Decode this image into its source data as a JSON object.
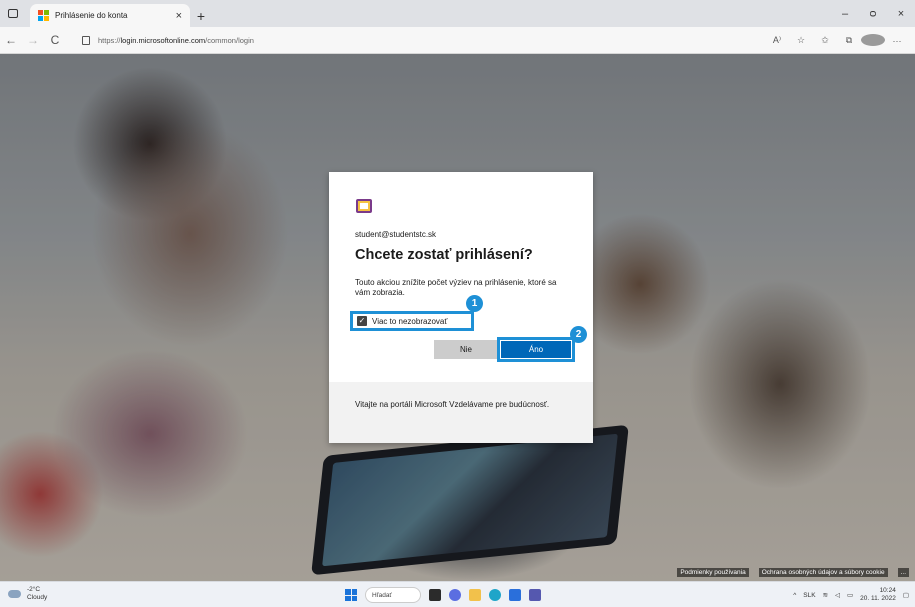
{
  "browser": {
    "tab_title": "Prihlásenie do konta",
    "tab_close": "×",
    "new_tab": "+",
    "url_prefix": "https://",
    "url_host": "login.microsoftonline.com",
    "url_path": "/common/login",
    "window_controls": {
      "minimize": "–",
      "restore": "ᴑ",
      "close": "×"
    },
    "nav": {
      "back": "←",
      "forward": "→",
      "refresh": "C"
    },
    "addr_icons": {
      "read_aloud": "A⁾",
      "favorites_add": "☆",
      "favorites": "✩",
      "collections": "⧉",
      "more": "···"
    }
  },
  "dialog": {
    "email": "student@studentstc.sk",
    "heading": "Chcete zostať prihlásení?",
    "description": "Touto akciou znížite počet výziev na prihlásenie, ktoré sa vám zobrazia.",
    "checkbox_label": "Viac to nezobrazovať",
    "checkbox_checked": true,
    "checkmark": "✓",
    "button_no": "Nie",
    "button_yes": "Áno",
    "footer_text": "Vitajte na portáli Microsoft Vzdelávame pre budúcnosť."
  },
  "markers": {
    "marker1": "1",
    "marker2": "2"
  },
  "footer_links": {
    "terms": "Podmienky používania",
    "privacy": "Ochrana osobných údajov a súbory cookie",
    "more": "..."
  },
  "taskbar": {
    "weather_temp": "-2°C",
    "weather_desc": "Cloudy",
    "search_label": "Hľadať",
    "language": "SLK",
    "time": "10:24",
    "date": "20. 11. 2022"
  },
  "colors": {
    "accent_highlight": "#1e90d6",
    "primary_button": "#0067b8",
    "secondary_button": "#cccccc"
  }
}
